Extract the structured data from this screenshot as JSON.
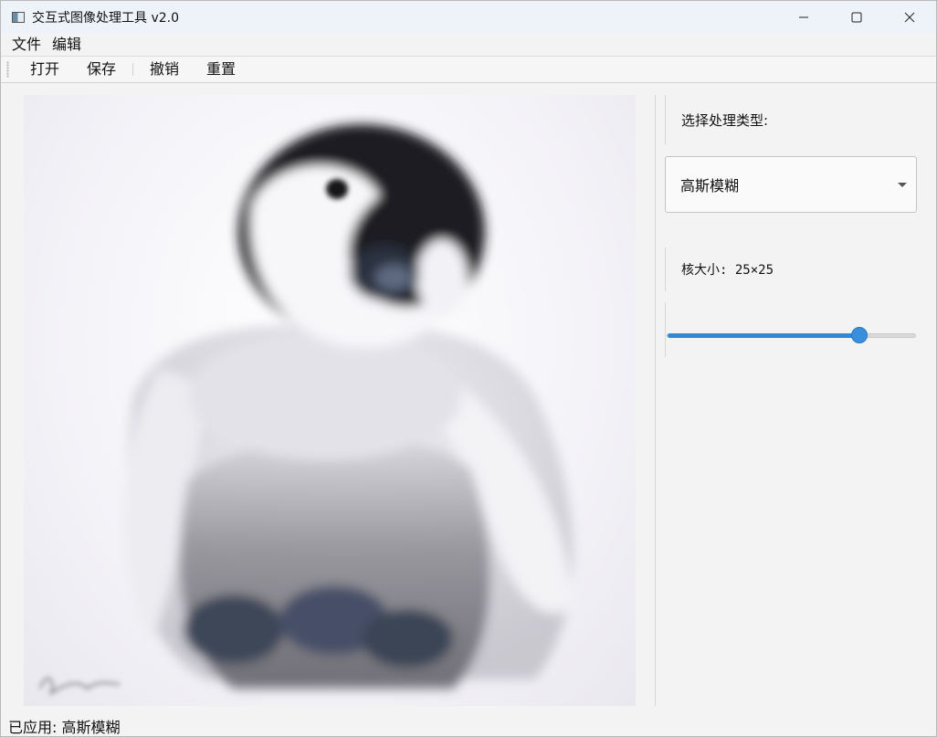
{
  "window": {
    "title": "交互式图像处理工具 v2.0",
    "controls": {
      "minimize": "minimize-icon",
      "maximize": "maximize-icon",
      "close": "close-icon"
    }
  },
  "menu": {
    "items": [
      "文件",
      "编辑"
    ]
  },
  "toolbar": {
    "buttons": [
      "打开",
      "保存",
      "撤销",
      "重置"
    ]
  },
  "panel": {
    "type_label": "选择处理类型:",
    "type_selected": "高斯模糊",
    "kernel_label": "核大小: 25×25",
    "slider_fraction": 0.77
  },
  "status": {
    "text": "已应用: 高斯模糊"
  },
  "colors": {
    "accent": "#2f88d8",
    "titlebar": "#eef2f9",
    "background": "#f3f3f3"
  }
}
